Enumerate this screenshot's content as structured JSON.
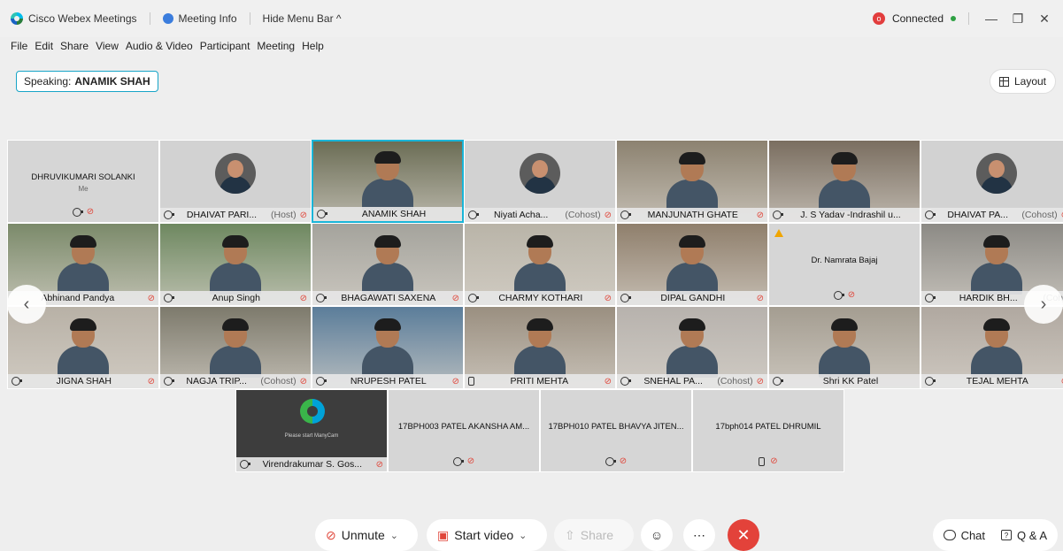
{
  "titlebar": {
    "app_name": "Cisco Webex Meetings",
    "meeting_info": "Meeting Info",
    "hide_menu": "Hide Menu Bar ^",
    "connection": "Connected",
    "rec_badge": "o"
  },
  "menu": [
    "File",
    "Edit",
    "Share",
    "View",
    "Audio & Video",
    "Participant",
    "Meeting",
    "Help"
  ],
  "speaking": {
    "label": "Speaking:",
    "name": "ANAMIK SHAH"
  },
  "layout_label": "Layout",
  "tiles": [
    {
      "type": "name",
      "name": "DHRUVIKUMARI SOLANKI",
      "sub": "Me",
      "audio": "audio",
      "muted": true
    },
    {
      "type": "avatar",
      "name": "DHAIVAT PARI...",
      "tag": "(Host)",
      "audio": "audio",
      "muted": true
    },
    {
      "type": "video",
      "name": "ANAMIK SHAH",
      "tag": "",
      "audio": "audio",
      "muted": false,
      "active": true,
      "bg": "#6b6d55"
    },
    {
      "type": "avatar",
      "name": "Niyati Acha...",
      "tag": "(Cohost)",
      "audio": "audio",
      "muted": true
    },
    {
      "type": "video",
      "name": "MANJUNATH GHATE",
      "tag": "",
      "audio": "audio",
      "muted": true,
      "bg": "#8c8270"
    },
    {
      "type": "video",
      "name": "J. S Yadav -Indrashil u...",
      "tag": "",
      "audio": "audio",
      "muted": false,
      "bg": "#7a6e60"
    },
    {
      "type": "avatar",
      "name": "DHAIVAT PA...",
      "tag": "(Cohost)",
      "audio": "audio",
      "muted": true
    },
    {
      "type": "video",
      "name": "Abhinand Pandya",
      "tag": "",
      "audio": "",
      "muted": true,
      "bg": "#7b8a6a"
    },
    {
      "type": "video",
      "name": "Anup Singh",
      "tag": "",
      "audio": "audio",
      "muted": true,
      "bg": "#6e8860"
    },
    {
      "type": "video",
      "name": "BHAGAWATI SAXENA",
      "tag": "",
      "audio": "audio",
      "muted": true,
      "bg": "#a4a39c"
    },
    {
      "type": "video",
      "name": "CHARMY KOTHARI",
      "tag": "",
      "audio": "audio",
      "muted": true,
      "bg": "#b9b4a8"
    },
    {
      "type": "video",
      "name": "DIPAL GANDHI",
      "tag": "",
      "audio": "audio",
      "muted": true,
      "bg": "#8f7f6c"
    },
    {
      "type": "name",
      "name": "Dr. Namrata Bajaj",
      "sub": "",
      "audio": "audio",
      "muted": true,
      "warn": true
    },
    {
      "type": "video",
      "name": "HARDIK BH...",
      "tag": "(Coho",
      "audio": "audio",
      "muted": false,
      "bg": "#8c8a85"
    },
    {
      "type": "video",
      "name": "JIGNA SHAH",
      "tag": "",
      "audio": "audio",
      "muted": true,
      "bg": "#b8b1a6"
    },
    {
      "type": "video",
      "name": "NAGJA TRIP...",
      "tag": "(Cohost)",
      "audio": "audio",
      "muted": true,
      "bg": "#7d7a6c"
    },
    {
      "type": "video",
      "name": "NRUPESH PATEL",
      "tag": "",
      "audio": "audio",
      "muted": true,
      "bg": "#5b7d9a"
    },
    {
      "type": "video",
      "name": "PRITI MEHTA",
      "tag": "",
      "audio": "phone",
      "muted": true,
      "bg": "#9a8f80"
    },
    {
      "type": "video",
      "name": "SNEHAL PA...",
      "tag": "(Cohost)",
      "audio": "audio",
      "muted": true,
      "bg": "#b7b2ad"
    },
    {
      "type": "video",
      "name": "Shri KK Patel",
      "tag": "",
      "audio": "audio",
      "muted": false,
      "bg": "#a49d91"
    },
    {
      "type": "video",
      "name": "TEJAL MEHTA",
      "tag": "",
      "audio": "audio",
      "muted": true,
      "bg": "#b0a8a0"
    }
  ],
  "row4": [
    {
      "type": "manycam",
      "name": "Virendrakumar S. Gos...",
      "audio": "audio",
      "muted": true,
      "text": "Please start ManyCam"
    },
    {
      "type": "name",
      "name": "17BPH003 PATEL AKANSHA AM...",
      "audio": "audio",
      "muted": true
    },
    {
      "type": "name",
      "name": "17BPH010 PATEL BHAVYA JITEN...",
      "audio": "audio",
      "muted": true
    },
    {
      "type": "name",
      "name": "17bph014 PATEL DHRUMIL",
      "audio": "phone",
      "muted": true
    }
  ],
  "controls": {
    "unmute": "Unmute",
    "start_video": "Start video",
    "share": "Share",
    "chat": "Chat",
    "qa": "Q & A"
  }
}
